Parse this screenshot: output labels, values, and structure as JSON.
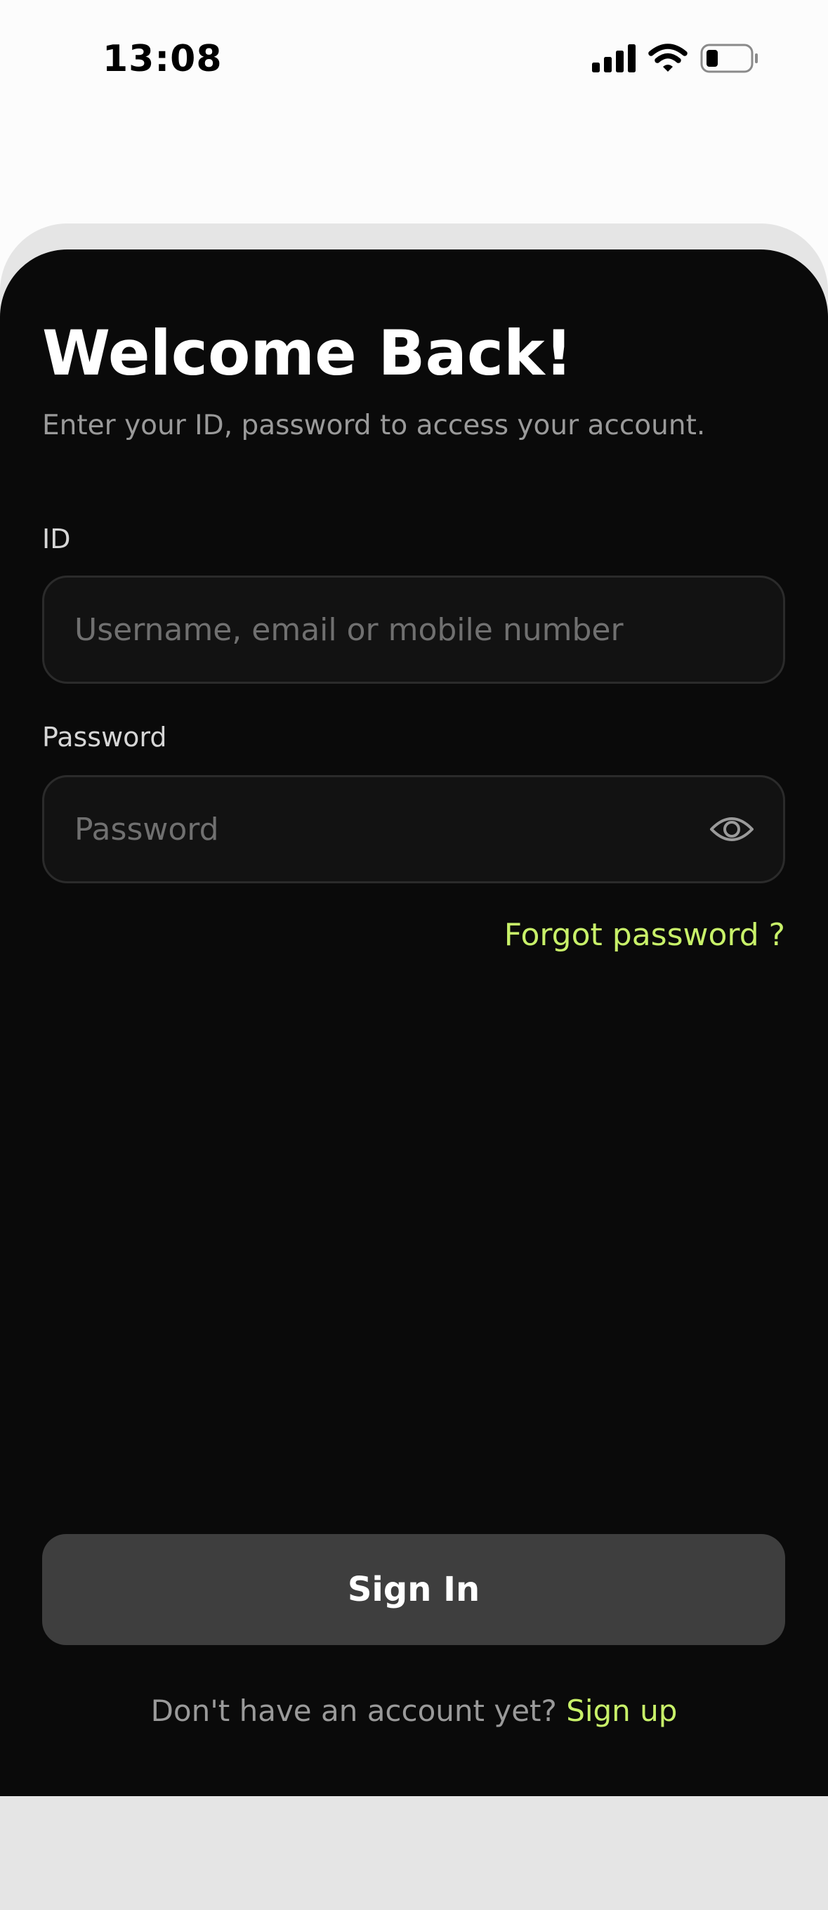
{
  "status_bar": {
    "time": "13:08",
    "icons": [
      "cellular-signal-icon",
      "wifi-icon",
      "battery-icon"
    ]
  },
  "login": {
    "title": "Welcome Back!",
    "subtitle": "Enter your ID, password to access your account.",
    "id_label": "ID",
    "id_placeholder": "Username, email or mobile number",
    "id_value": "",
    "password_label": "Password",
    "password_placeholder": "Password",
    "password_value": "",
    "forgot_label": "Forgot password ?",
    "signin_label": "Sign In",
    "signup_prompt": "Don't have an account yet?",
    "signup_link": "Sign up"
  },
  "colors": {
    "background": "#0a0a0a",
    "accent": "#c8f169",
    "button": "#3e3e3e",
    "input_bg": "#121212",
    "input_border": "#2b2b2b"
  }
}
